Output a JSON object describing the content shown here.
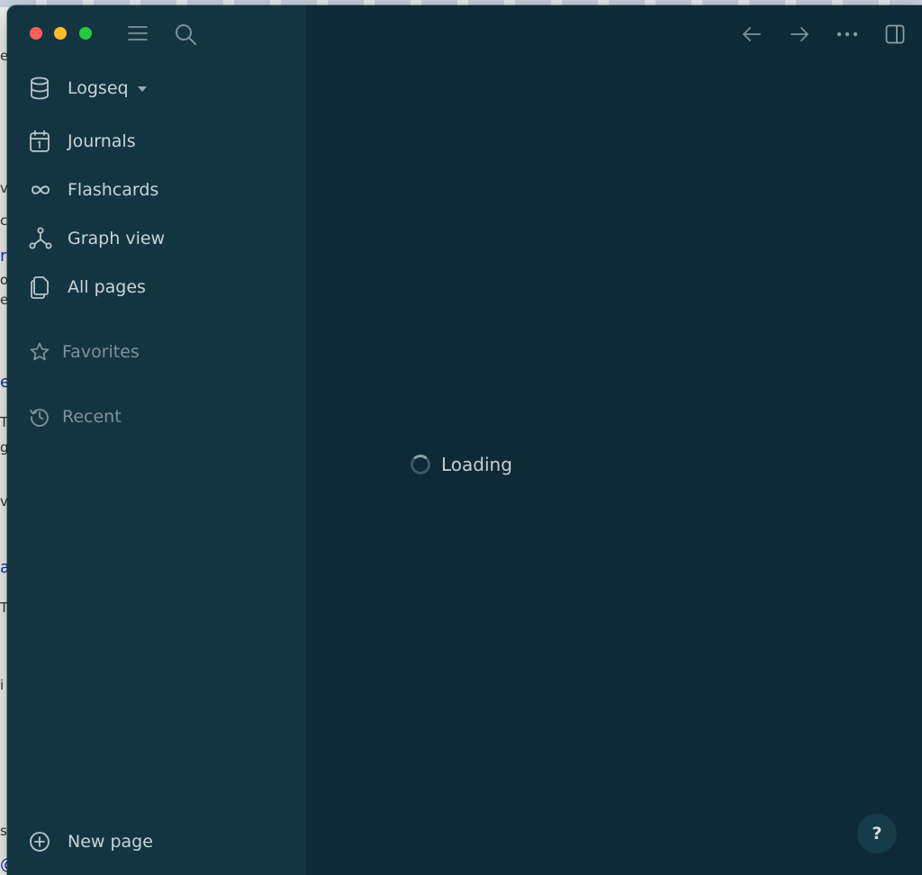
{
  "sidebar": {
    "graph_name": "Logseq",
    "nav_items": [
      {
        "label": "Journals"
      },
      {
        "label": "Flashcards"
      },
      {
        "label": "Graph view"
      },
      {
        "label": "All pages"
      }
    ],
    "sections": [
      {
        "label": "Favorites"
      },
      {
        "label": "Recent"
      }
    ],
    "new_page_label": "New page"
  },
  "main": {
    "loading_text": "Loading",
    "help_label": "?"
  },
  "background": {
    "fragments": [
      "e",
      "vi",
      "c",
      "re",
      "or",
      "er",
      "e",
      "T",
      "g",
      "vi",
      "a",
      "T",
      "i",
      "s",
      "@"
    ]
  },
  "colors": {
    "sidebar_bg": "#133542",
    "main_bg": "#0e2a36",
    "traffic_red": "#fe5f57",
    "traffic_yellow": "#febc2e",
    "traffic_green": "#28c840"
  },
  "icons": {
    "menu": "hamburger-icon",
    "search": "search-icon",
    "back": "arrow-left-icon",
    "forward": "arrow-right-icon",
    "more": "more-dots-icon",
    "right_sidebar": "right-sidebar-toggle-icon"
  }
}
